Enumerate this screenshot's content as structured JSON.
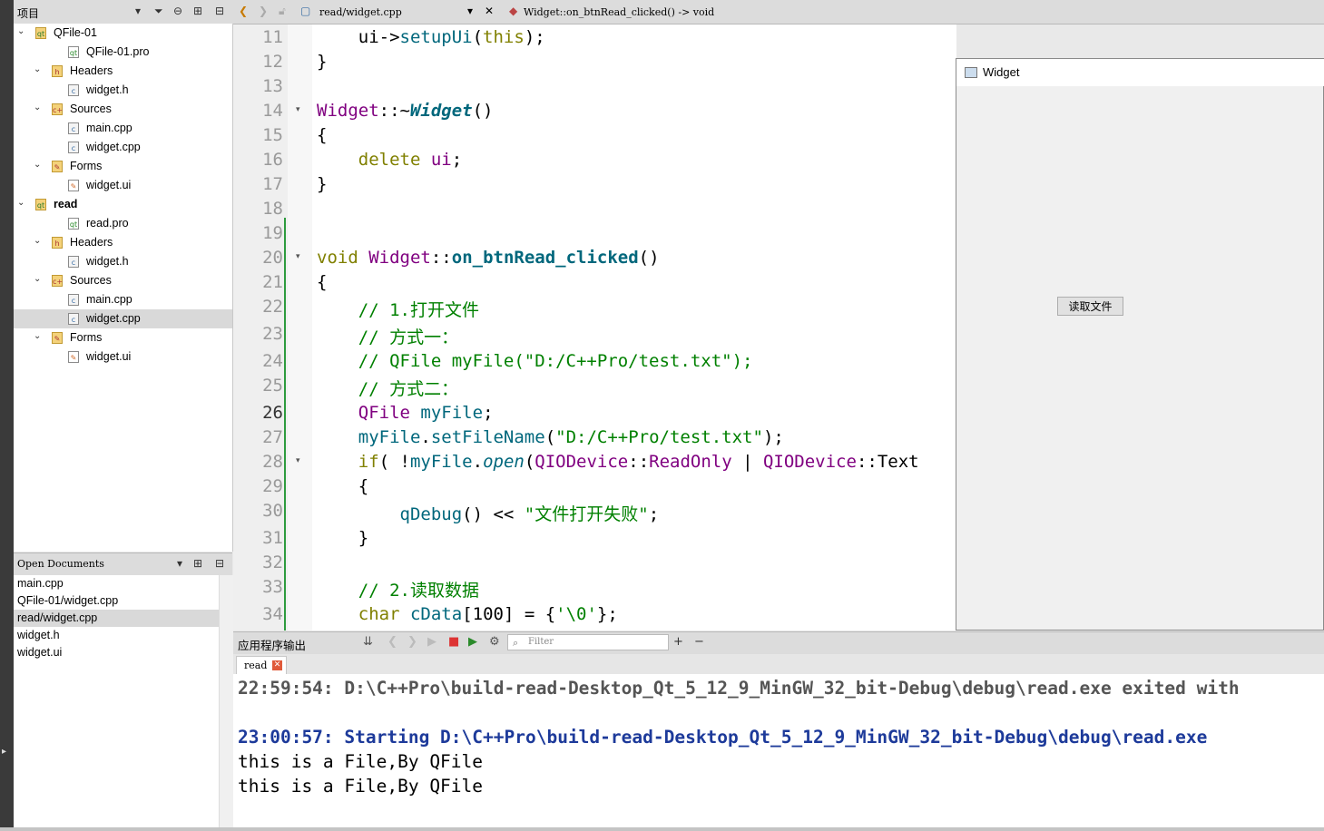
{
  "project_panel": {
    "title": "项目",
    "tree": [
      {
        "label": "QFile-01",
        "level": 0,
        "kind": "project",
        "expanded": true,
        "bold": false
      },
      {
        "label": "QFile-01.pro",
        "level": 2,
        "kind": "pro-file"
      },
      {
        "label": "Headers",
        "level": 1,
        "kind": "folder-h",
        "expanded": true
      },
      {
        "label": "widget.h",
        "level": 2,
        "kind": "source-file"
      },
      {
        "label": "Sources",
        "level": 1,
        "kind": "folder-cpp",
        "expanded": true
      },
      {
        "label": "main.cpp",
        "level": 2,
        "kind": "source-file"
      },
      {
        "label": "widget.cpp",
        "level": 2,
        "kind": "source-file"
      },
      {
        "label": "Forms",
        "level": 1,
        "kind": "folder-ui",
        "expanded": true
      },
      {
        "label": "widget.ui",
        "level": 2,
        "kind": "ui-file"
      },
      {
        "label": "read",
        "level": 0,
        "kind": "project",
        "expanded": true,
        "bold": true
      },
      {
        "label": "read.pro",
        "level": 2,
        "kind": "pro-file"
      },
      {
        "label": "Headers",
        "level": 1,
        "kind": "folder-h",
        "expanded": true
      },
      {
        "label": "widget.h",
        "level": 2,
        "kind": "source-file"
      },
      {
        "label": "Sources",
        "level": 1,
        "kind": "folder-cpp",
        "expanded": true
      },
      {
        "label": "main.cpp",
        "level": 2,
        "kind": "source-file"
      },
      {
        "label": "widget.cpp",
        "level": 2,
        "kind": "source-file",
        "selected": true
      },
      {
        "label": "Forms",
        "level": 1,
        "kind": "folder-ui",
        "expanded": true
      },
      {
        "label": "widget.ui",
        "level": 2,
        "kind": "ui-file"
      }
    ]
  },
  "open_documents": {
    "title": "Open Documents",
    "items": [
      {
        "label": "main.cpp"
      },
      {
        "label": "QFile-01/widget.cpp"
      },
      {
        "label": "read/widget.cpp",
        "selected": true
      },
      {
        "label": "widget.h"
      },
      {
        "label": "widget.ui"
      }
    ]
  },
  "editor_toolbar": {
    "file": "read/widget.cpp",
    "symbol": "Widget::on_btnRead_clicked() -> void"
  },
  "editor": {
    "current_line": 26,
    "lines": [
      {
        "n": "11",
        "fold": false,
        "html": "    ui-><span class='fn'>setupUi</span>(<span class='kw'>this</span>);"
      },
      {
        "n": "12",
        "fold": false,
        "html": "}"
      },
      {
        "n": "13",
        "fold": false,
        "html": ""
      },
      {
        "n": "14",
        "fold": true,
        "html": "<span class='ty'>Widget</span>::~<span class='fn it b'>Widget</span>()"
      },
      {
        "n": "15",
        "fold": false,
        "html": "{"
      },
      {
        "n": "16",
        "fold": false,
        "html": "    <span class='kw'>delete</span> <span class='ty'>ui</span>;"
      },
      {
        "n": "17",
        "fold": false,
        "html": "}"
      },
      {
        "n": "18",
        "fold": false,
        "html": ""
      },
      {
        "n": "19",
        "fold": false,
        "html": ""
      },
      {
        "n": "20",
        "fold": true,
        "html": "<span class='kw'>void</span> <span class='ty'>Widget</span>::<span class='fn b'>on_btnRead_clicked</span>()"
      },
      {
        "n": "21",
        "fold": false,
        "html": "{"
      },
      {
        "n": "22",
        "fold": false,
        "html": "    <span class='cm'>// 1.打开文件</span>"
      },
      {
        "n": "23",
        "fold": false,
        "html": "    <span class='cm'>// 方式一：</span>"
      },
      {
        "n": "24",
        "fold": false,
        "html": "    <span class='cm'>// QFile myFile(\"D:/C++Pro/test.txt\");</span>"
      },
      {
        "n": "25",
        "fold": false,
        "html": "    <span class='cm'>// 方式二：</span>"
      },
      {
        "n": "26",
        "fold": false,
        "html": "    <span class='ty'>QFile</span> <span class='fn'>myFile</span>;"
      },
      {
        "n": "27",
        "fold": false,
        "html": "    <span class='fn'>myFile</span>.<span class='fn'>setFileName</span>(<span class='st'>\"D:/C++Pro/test.txt\"</span>);"
      },
      {
        "n": "28",
        "fold": true,
        "html": "    <span class='kw'>if</span>( !<span class='fn'>myFile</span>.<span class='fn it'>open</span>(<span class='ty'>QIODevice</span>::<span class='ty'>ReadOnly</span> | <span class='ty'>QIODevice</span>::Text"
      },
      {
        "n": "29",
        "fold": false,
        "html": "    {"
      },
      {
        "n": "30",
        "fold": false,
        "html": "        <span class='fn'>qDebug</span>() << <span class='st'>\"文件打开失败\"</span>;"
      },
      {
        "n": "31",
        "fold": false,
        "html": "    }"
      },
      {
        "n": "32",
        "fold": false,
        "html": ""
      },
      {
        "n": "33",
        "fold": false,
        "html": "    <span class='cm'>// 2.读取数据</span>"
      },
      {
        "n": "34",
        "fold": false,
        "html": "    <span class='kw'>char</span> <span class='fn'>cData</span>[100] = {<span class='st'>'\\0'</span>};"
      }
    ]
  },
  "widget_window": {
    "title": "Widget",
    "button_label": "读取文件"
  },
  "output_panel": {
    "title": "应用程序输出",
    "filter_placeholder": "Filter",
    "tab_label": "read",
    "lines": [
      {
        "kind": "msg",
        "text": "22:59:54: D:\\C++Pro\\build-read-Desktop_Qt_5_12_9_MinGW_32_bit-Debug\\debug\\read.exe exited with"
      },
      {
        "kind": "blank",
        "text": ""
      },
      {
        "kind": "start",
        "text": "23:00:57: Starting D:\\C++Pro\\build-read-Desktop_Qt_5_12_9_MinGW_32_bit-Debug\\debug\\read.exe"
      },
      {
        "kind": "plain",
        "text": "this is a File,By QFile"
      },
      {
        "kind": "plain",
        "text": "this is a File,By QFile"
      }
    ]
  }
}
